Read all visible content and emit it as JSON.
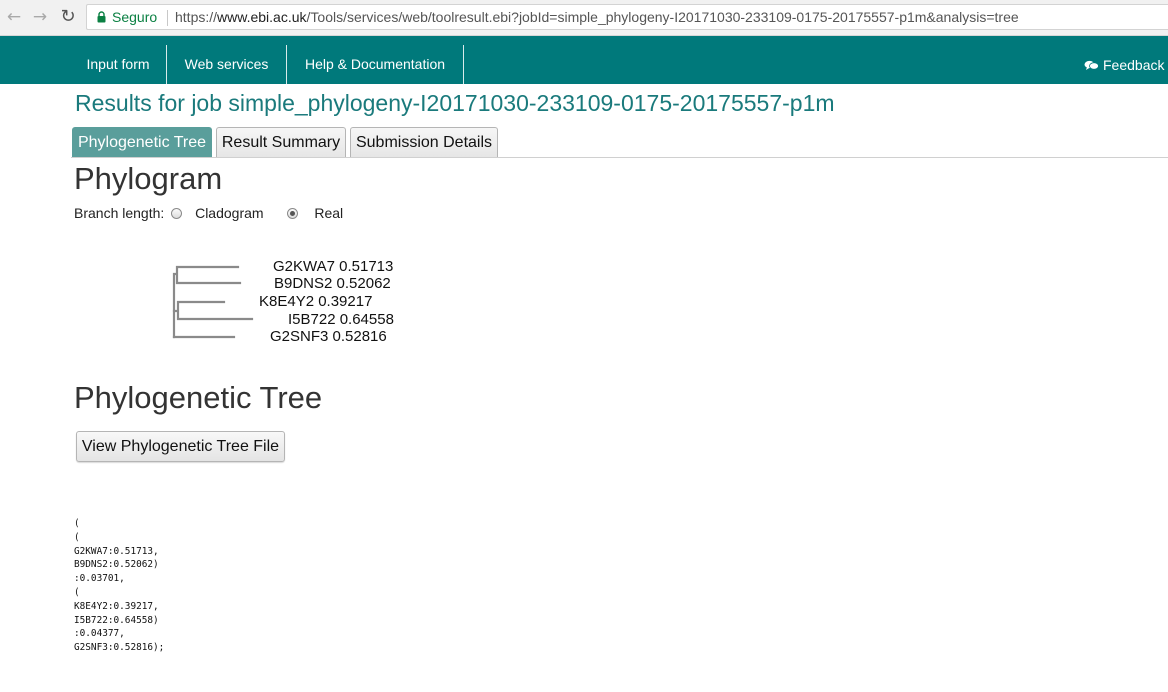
{
  "browser": {
    "secure_label": "Seguro",
    "url_scheme": "https://",
    "url_domain": "www.ebi.ac.uk",
    "url_path": "/Tools/services/web/toolresult.ebi?jobId=simple_phylogeny-I20171030-233109-0175-20175557-p1m&analysis=tree"
  },
  "nav": {
    "items": [
      "Input form",
      "Web services",
      "Help & Documentation"
    ],
    "feedback": "Feedback"
  },
  "page": {
    "title": "Results for job simple_phylogeny-I20171030-233109-0175-20175557-p1m",
    "tabs": [
      {
        "label": "Phylogenetic Tree",
        "active": true
      },
      {
        "label": "Result Summary",
        "active": false
      },
      {
        "label": "Submission Details",
        "active": false
      }
    ]
  },
  "phylogram": {
    "heading": "Phylogram",
    "branch_length_label": "Branch length:",
    "options": [
      {
        "label": "Cladogram",
        "selected": false
      },
      {
        "label": "Real",
        "selected": true
      }
    ],
    "leaves": [
      "G2KWA7 0.51713",
      "B9DNS2 0.52062",
      "K8E4Y2 0.39217",
      "I5B722 0.64558",
      "G2SNF3 0.52816"
    ]
  },
  "tree_section": {
    "heading": "Phylogenetic Tree",
    "view_button": "View Phylogenetic Tree File",
    "newick": "(\n(\nG2KWA7:0.51713,\nB9DNS2:0.52062)\n:0.03701,\n(\nK8E4Y2:0.39217,\nI5B722:0.64558)\n:0.04377,\nG2SNF3:0.52816);"
  }
}
